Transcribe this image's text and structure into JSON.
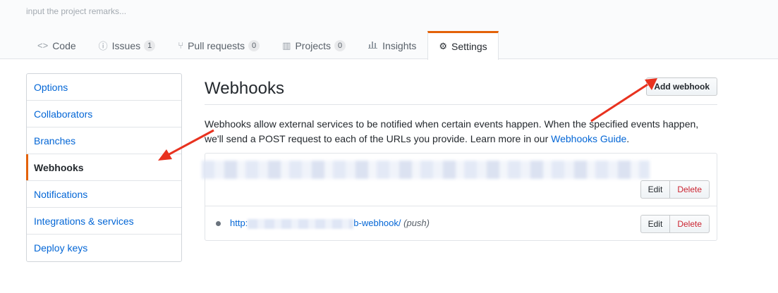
{
  "repo": {
    "remarks_placeholder": "input the project remarks..."
  },
  "tabs": [
    {
      "label": "Code",
      "icon": "code-icon",
      "glyph": "<>",
      "count": ""
    },
    {
      "label": "Issues",
      "icon": "issue-icon",
      "glyph": "ⓘ",
      "count": "1"
    },
    {
      "label": "Pull requests",
      "icon": "pull-request-icon",
      "glyph": "⑂",
      "count": "0"
    },
    {
      "label": "Projects",
      "icon": "project-icon",
      "glyph": "▥",
      "count": "0"
    },
    {
      "label": "Insights",
      "icon": "graph-icon",
      "glyph": "📊",
      "count": ""
    },
    {
      "label": "Settings",
      "icon": "gear-icon",
      "glyph": "⚙",
      "count": ""
    }
  ],
  "sidebar": {
    "items": [
      {
        "label": "Options"
      },
      {
        "label": "Collaborators"
      },
      {
        "label": "Branches"
      },
      {
        "label": "Webhooks"
      },
      {
        "label": "Notifications"
      },
      {
        "label": "Integrations & services"
      },
      {
        "label": "Deploy keys"
      }
    ]
  },
  "main": {
    "title": "Webhooks",
    "add_button": "Add webhook",
    "description": "Webhooks allow external services to be notified when certain events happen. When the specified events happen, we'll send a POST request to each of the URLs you provide. Learn more in our ",
    "guide_link": "Webhooks Guide",
    "description_end": ".",
    "hooks": [
      {
        "edit": "Edit",
        "delete": "Delete"
      },
      {
        "url_start": "http:",
        "url_end": "b-webhook/",
        "events": "(push)",
        "edit": "Edit",
        "delete": "Delete"
      }
    ]
  },
  "colors": {
    "accent": "#e36209",
    "link": "#0366d6",
    "danger": "#cb2431",
    "arrow": "#e8321f"
  }
}
